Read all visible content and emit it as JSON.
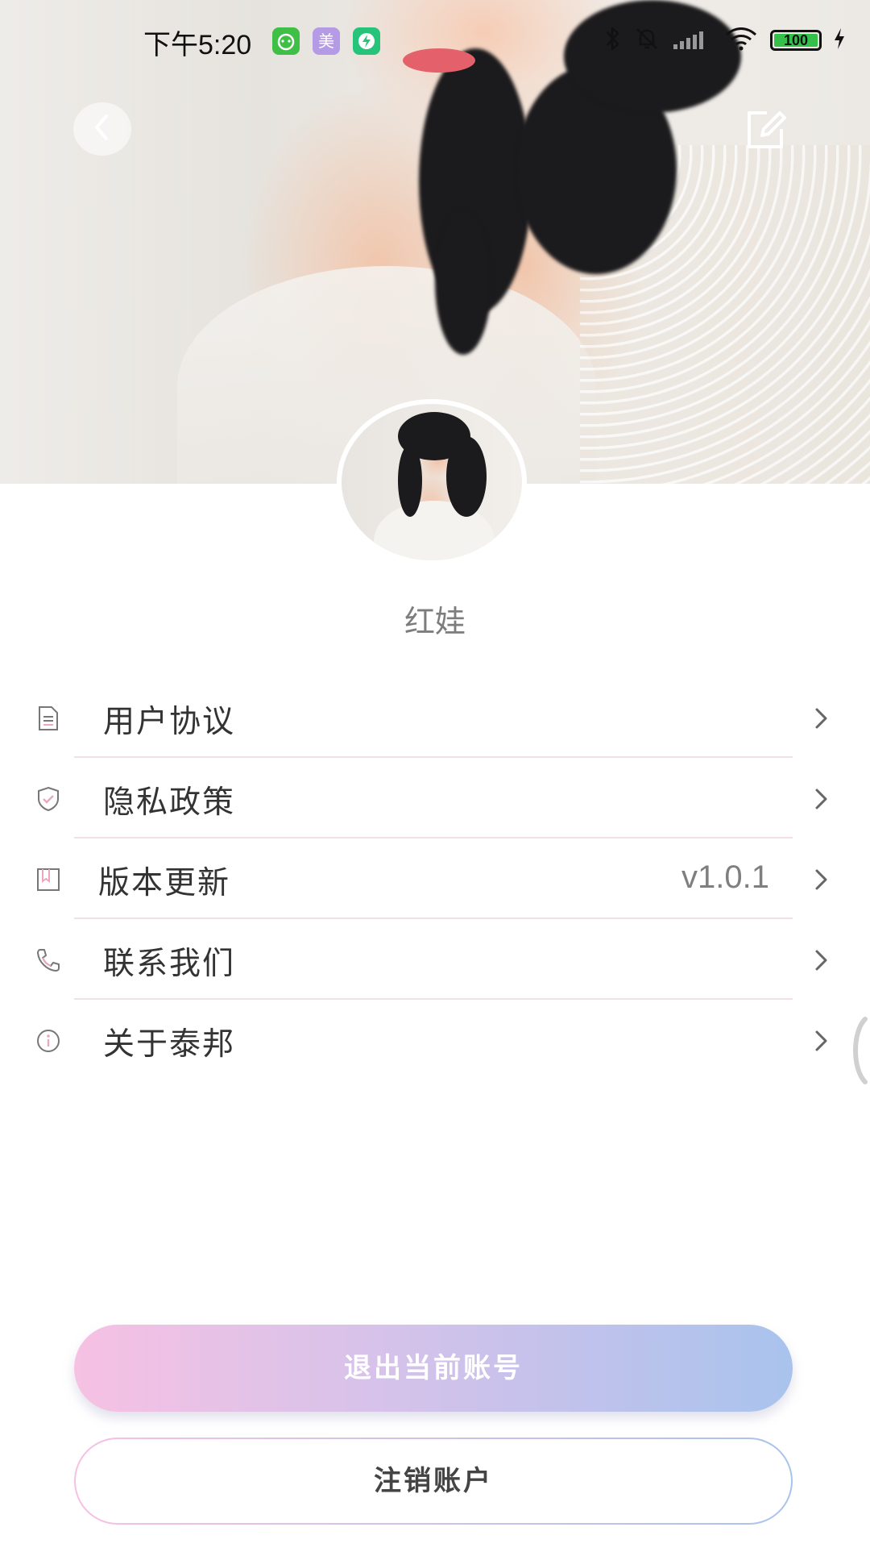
{
  "status_bar": {
    "time": "下午5:20",
    "notification_icons": [
      "qq-pet-app-icon",
      "mei-app-icon",
      "security-app-icon"
    ],
    "mei_badge": "美",
    "battery_level": "100",
    "battery_fraction": 1.0
  },
  "header": {
    "back_icon": "chevron-left-icon",
    "edit_icon": "edit-icon"
  },
  "profile": {
    "name": "红娃"
  },
  "menu": {
    "items": [
      {
        "label": "用户协议",
        "icon": "document-icon",
        "value": ""
      },
      {
        "label": "隐私政策",
        "icon": "shield-icon",
        "value": ""
      },
      {
        "label": "版本更新",
        "icon": "bookmark-icon",
        "value": "v1.0.1"
      },
      {
        "label": "联系我们",
        "icon": "phone-icon",
        "value": ""
      },
      {
        "label": "关于泰邦",
        "icon": "info-icon",
        "value": ""
      }
    ]
  },
  "actions": {
    "logout_label": "退出当前账号",
    "cancel_account_label": "注销账户"
  },
  "colors": {
    "accent_pink": "#f6c1e3",
    "accent_blue": "#a9c3ed",
    "divider": "#f1e1e6",
    "text_primary": "#333333",
    "text_secondary": "#7d7d7d"
  }
}
